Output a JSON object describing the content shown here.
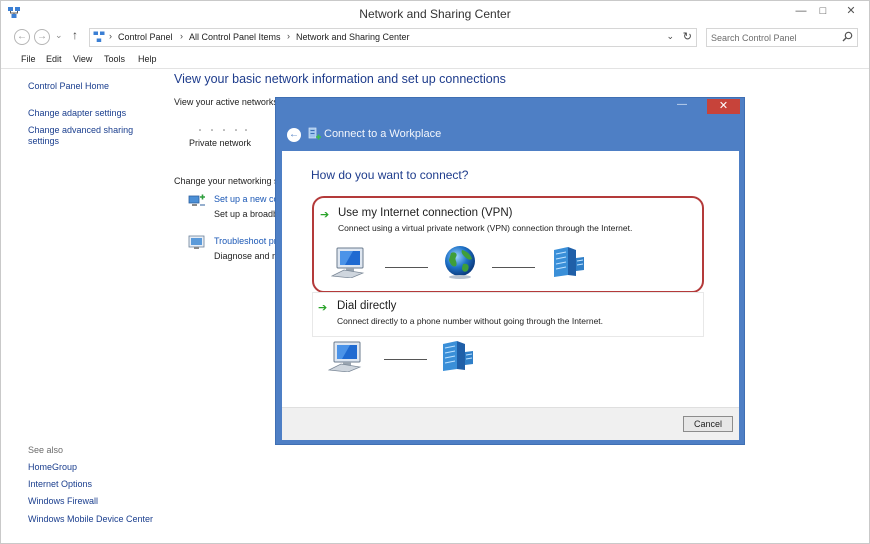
{
  "window": {
    "title": "Network and Sharing Center",
    "min": "—",
    "max": "□",
    "close": "✕"
  },
  "nav": {
    "back": "←",
    "forward": "→",
    "recent": "⌄",
    "up": "↑"
  },
  "address": {
    "crumbs": [
      "Control Panel",
      "All Control Panel Items",
      "Network and Sharing Center"
    ],
    "sep": "›",
    "dropdown": "⌄",
    "refresh": "↻"
  },
  "search": {
    "placeholder": "Search Control Panel"
  },
  "menu": [
    "File",
    "Edit",
    "View",
    "Tools",
    "Help"
  ],
  "left_pane": {
    "home": "Control Panel Home",
    "links": [
      "Change adapter settings",
      "Change advanced sharing settings"
    ],
    "see_also_label": "See also",
    "see_also": [
      "HomeGroup",
      "Internet Options",
      "Windows Firewall",
      "Windows Mobile Device Center"
    ]
  },
  "main": {
    "heading": "View your basic network information and set up connections",
    "active_networks": "View your active networks",
    "network_name": "Private network",
    "change_settings": "Change your networking s",
    "setup_link": "Set up a new co",
    "setup_desc": "Set up a broadb",
    "troubleshoot_link": "Troubleshoot pr",
    "troubleshoot_desc": "Diagnose and re"
  },
  "dialog": {
    "title": "Connect to a Workplace",
    "question": "How do you want to connect?",
    "options": [
      {
        "title": "Use my Internet connection (VPN)",
        "desc": "Connect using a virtual private network (VPN) connection through the Internet."
      },
      {
        "title": "Dial directly",
        "desc": "Connect directly to a phone number without going through the Internet."
      }
    ],
    "cancel": "Cancel",
    "back": "←",
    "min": "—",
    "max": "□",
    "close": "✕",
    "arrow": "➔"
  },
  "colors": {
    "accent": "#4e7fc5",
    "link": "#1a3e8e",
    "heading": "#1e3c8c",
    "highlight_ring": "#b43a3a",
    "close_red": "#c7433a"
  }
}
